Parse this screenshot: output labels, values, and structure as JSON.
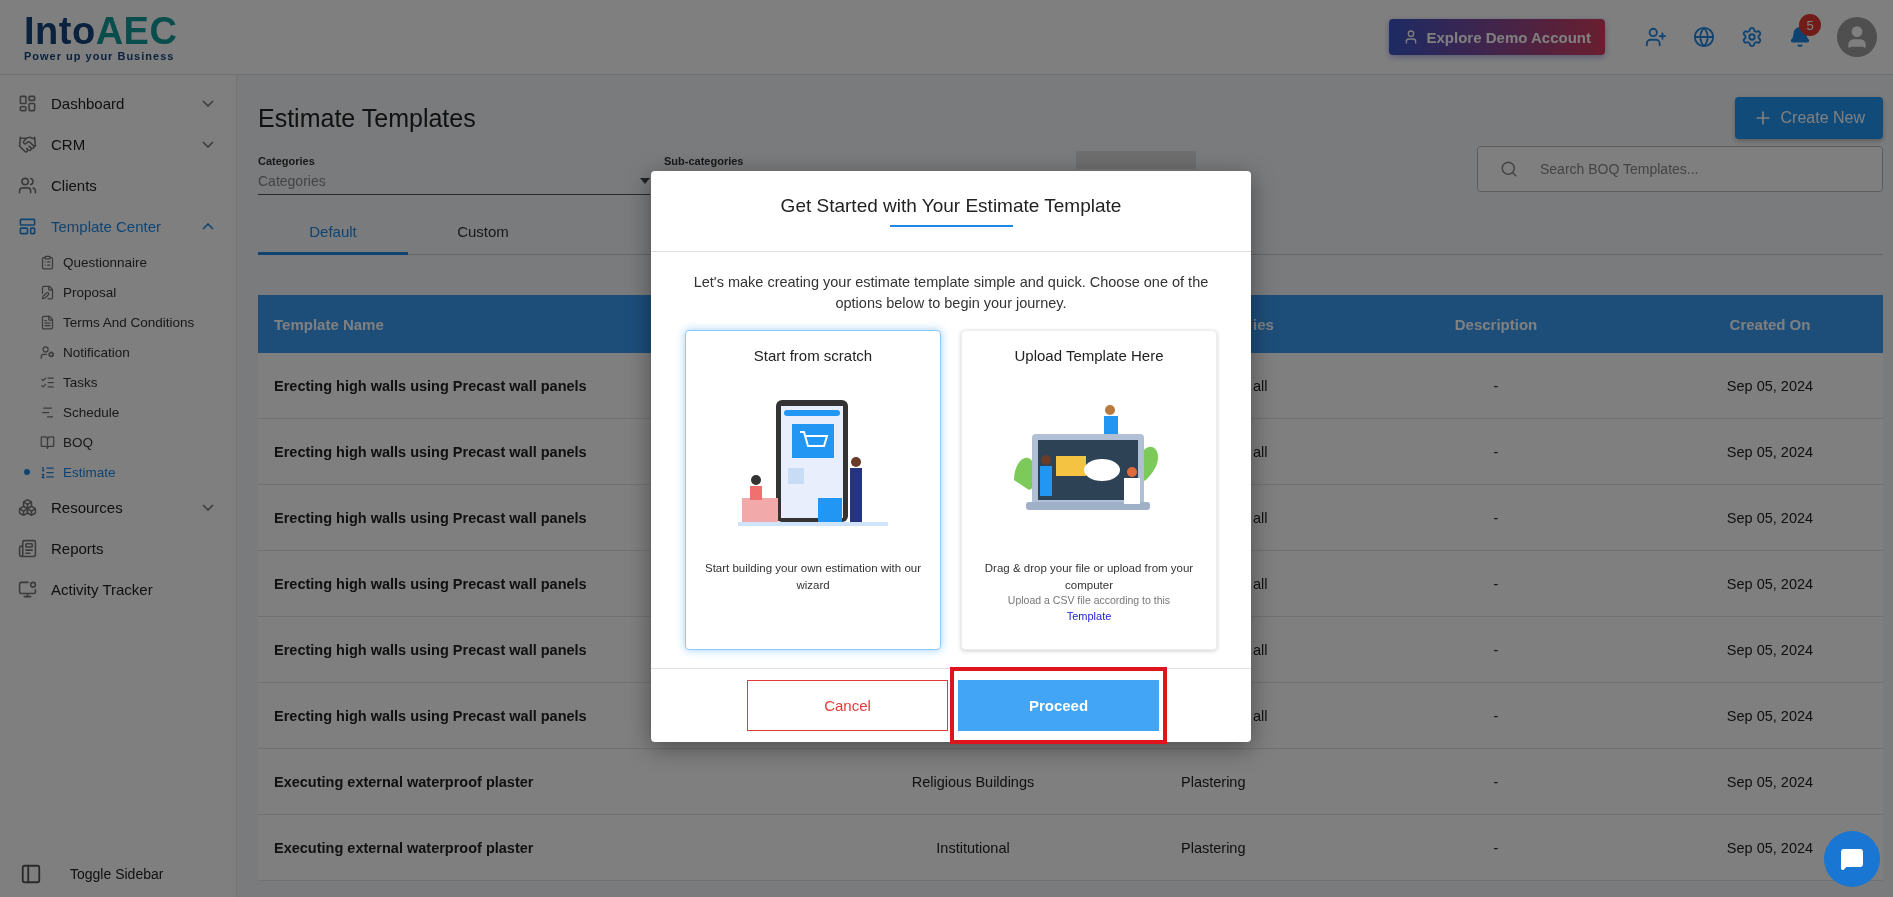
{
  "logo": {
    "brand_start": "Into",
    "brand_end": "AEC",
    "tagline": "Power up your Business"
  },
  "header": {
    "demo_button": "Explore Demo Account",
    "notification_count": "5"
  },
  "sidebar": {
    "items": [
      {
        "label": "Dashboard",
        "selected": false,
        "expanded": false
      },
      {
        "label": "CRM",
        "selected": false,
        "expanded": false
      },
      {
        "label": "Clients",
        "selected": false
      },
      {
        "label": "Template Center",
        "selected": true,
        "expanded": true,
        "children": [
          {
            "label": "Questionnaire",
            "selected": false
          },
          {
            "label": "Proposal",
            "selected": false
          },
          {
            "label": "Terms And Conditions",
            "selected": false
          },
          {
            "label": "Notification",
            "selected": false
          },
          {
            "label": "Tasks",
            "selected": false
          },
          {
            "label": "Schedule",
            "selected": false
          },
          {
            "label": "BOQ",
            "selected": false
          },
          {
            "label": "Estimate",
            "selected": true
          }
        ]
      },
      {
        "label": "Resources",
        "selected": false,
        "expanded": false
      },
      {
        "label": "Reports",
        "selected": false
      },
      {
        "label": "Activity Tracker",
        "selected": false
      }
    ],
    "toggle": "Toggle Sidebar"
  },
  "page": {
    "title": "Estimate Templates",
    "create_button": "Create New",
    "filters": {
      "categories_label": "Categories",
      "categories_placeholder": "Categories",
      "subcategories_label": "Sub-categories"
    },
    "search": {
      "placeholder": "Search BOQ Templates..."
    },
    "tabs": [
      {
        "label": "Default",
        "selected": true
      },
      {
        "label": "Custom",
        "selected": false
      }
    ]
  },
  "table": {
    "columns": [
      {
        "label": "Template Name"
      },
      {},
      {
        "label": "ies"
      },
      {
        "label": "Description"
      },
      {
        "label": "Created On"
      }
    ],
    "rows": [
      {
        "template_name": "Erecting high walls using Precast wall panels",
        "sub_category": "all",
        "description": "-",
        "created_on": "Sep 05, 2024"
      },
      {
        "template_name": "Erecting high walls using Precast wall panels",
        "sub_category": "all",
        "description": "-",
        "created_on": "Sep 05, 2024"
      },
      {
        "template_name": "Erecting high walls using Precast wall panels",
        "sub_category": "all",
        "description": "-",
        "created_on": "Sep 05, 2024"
      },
      {
        "template_name": "Erecting high walls using Precast wall panels",
        "sub_category": "all",
        "description": "-",
        "created_on": "Sep 05, 2024"
      },
      {
        "template_name": "Erecting high walls using Precast wall panels",
        "sub_category": "all",
        "description": "-",
        "created_on": "Sep 05, 2024"
      },
      {
        "template_name": "Erecting high walls using Precast wall panels",
        "sub_category": "all",
        "description": "-",
        "created_on": "Sep 05, 2024"
      },
      {
        "template_name": "Executing external waterproof plaster",
        "category": "Religious Buildings",
        "sub_category": "Plastering",
        "description": "-",
        "created_on": "Sep 05, 2024"
      },
      {
        "template_name": "Executing external waterproof plaster",
        "category": "Institutional",
        "sub_category": "Plastering",
        "description": "-",
        "created_on": "Sep 05, 2024"
      }
    ]
  },
  "modal": {
    "title": "Get Started with Your Estimate Template",
    "intro": "Let's make creating your estimate template simple and quick. Choose one of the options below to begin your journey.",
    "options": [
      {
        "kind": "scratch",
        "title": "Start from scratch",
        "description": "Start building your own estimation with our wizard",
        "selected": true
      },
      {
        "kind": "upload",
        "title": "Upload Template Here",
        "description": "Drag & drop your file or upload from your computer",
        "note": "Upload a CSV file according to this",
        "link": "Template",
        "selected": false
      }
    ],
    "cancel": "Cancel",
    "proceed": "Proceed",
    "proceed_highlighted": true
  }
}
